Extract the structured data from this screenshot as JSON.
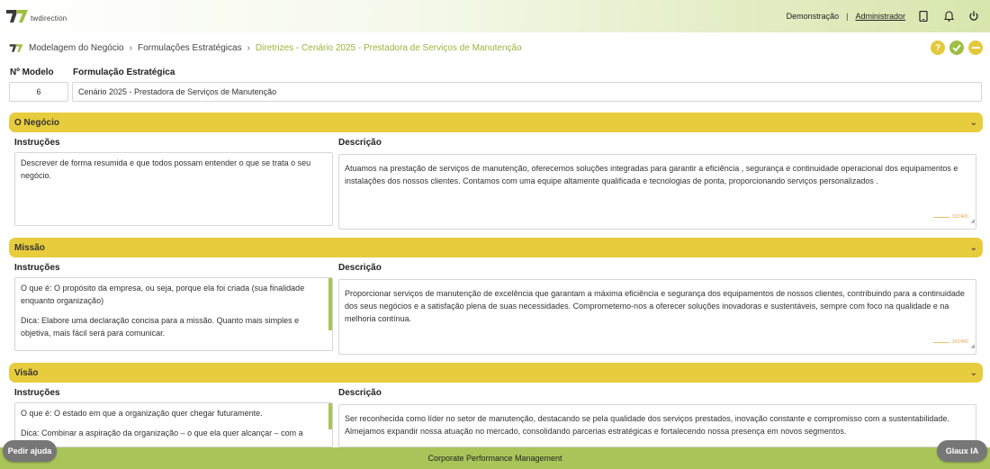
{
  "brand": {
    "name": "twdirection"
  },
  "topbar": {
    "mode": "Demonstração",
    "separator": "|",
    "user": "Administrador"
  },
  "breadcrumb": {
    "items": [
      "Modelagem do Negócio",
      "Formulações Estratégicas"
    ],
    "current": "Diretrizes - Cenário 2025 - Prestadora de Serviços de Manutenção"
  },
  "actions": {
    "help": "?"
  },
  "model": {
    "number_label": "Nº Modelo",
    "number_value": "6",
    "formulation_label": "Formulação Estratégica",
    "formulation_value": "Cenário 2025 - Prestadora de Serviços de Manutenção"
  },
  "sections": [
    {
      "title": "O Negócio",
      "instructions_label": "Instruções",
      "description_label": "Descrição",
      "instructions": [
        "Descrever de forma resumida e que todos possam entender o que se trata o seu negócio."
      ],
      "description": "Atuamos na prestação de serviços de manutenção, oferecemos soluções integradas para garantir a eficiência , segurança e continuidade operacional dos equipamentos e instalações dos nossos clientes. Contamos com uma equipe altamente qualificada e tecnologias de ponta, proporcionando serviços personalizados .",
      "counter": "337/400"
    },
    {
      "title": "Missão",
      "instructions_label": "Instruções",
      "description_label": "Descrição",
      "instructions": [
        "O que é: O propósito da empresa, ou seja, porque ela foi criada (sua finalidade enquanto organização)",
        "Dica: Elabore uma declaração concisa para a missão. Quanto mais simples e objetiva, mais fácil será para comunicar."
      ],
      "description": "Proporcionar serviços de manutenção de excelência que garantam a máxima eficiência e segurança dos equipamentos de nossos clientes, contribuindo para a continuidade dos seus negócios e a satisfação plena de suas necessidades. Comprometemo-nos a oferecer soluções inovadoras e sustentáveis, sempre com foco na qualidade e na melhoria contínua.",
      "counter": "342/400"
    },
    {
      "title": "Visão",
      "instructions_label": "Instruções",
      "description_label": "Descrição",
      "instructions": [
        "O que é: O estado em que a organização quer chegar futuramente.",
        "Dica: Combinar a aspiração da organização – o que ela quer alcançar – com a"
      ],
      "description": "Ser reconhecida como líder no setor de manutenção, destacando se pela qualidade dos serviços prestados, inovação constante e compromisso com a sustentabilidade. Almejamos expandir nossa atuação no mercado, consolidando parcerias estratégicas e fortalecendo nossa presença em novos segmentos.",
      "counter": ""
    }
  ],
  "footer": {
    "text": "Corporate Performance Management"
  },
  "help_button": "Pedir ajuda",
  "ai_button": "Glaux IA",
  "colors": {
    "accent": "#a9c55a",
    "section": "#e7cc3d",
    "current_crumb": "#9ab43a"
  }
}
